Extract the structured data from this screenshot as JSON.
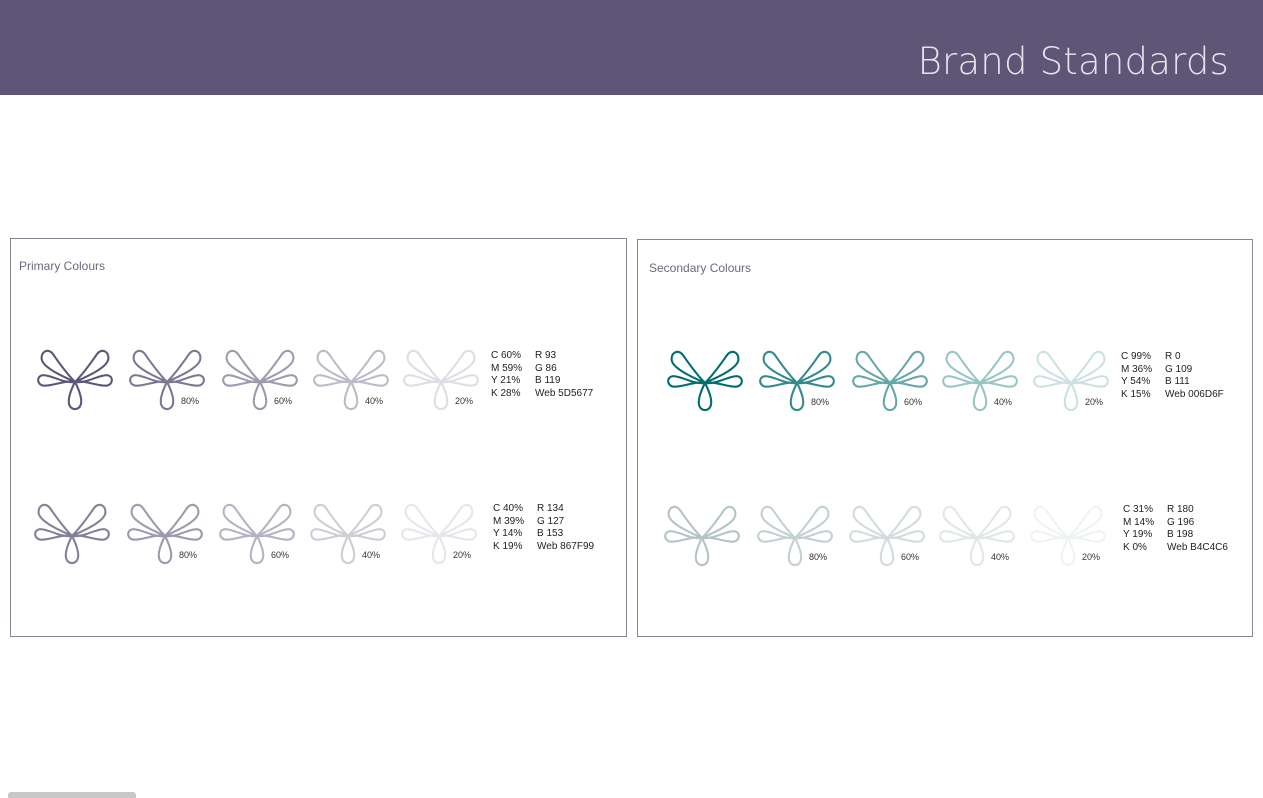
{
  "header": {
    "title": "Brand Standards",
    "bg_color": "#5d5677"
  },
  "primary": {
    "title": "Primary Colours",
    "rows": [
      {
        "color": "#5d5677",
        "tints": [
          {
            "value": 1.0,
            "label": ""
          },
          {
            "value": 0.8,
            "label": "80%"
          },
          {
            "value": 0.6,
            "label": "60%"
          },
          {
            "value": 0.4,
            "label": "40%"
          },
          {
            "value": 0.2,
            "label": "20%"
          }
        ],
        "cmyk": [
          "C 60%",
          "M 59%",
          "Y 21%",
          "K 28%"
        ],
        "rgb": [
          "R 93",
          "G 86",
          "B 119",
          "Web 5D5677"
        ]
      },
      {
        "color": "#867f99",
        "tints": [
          {
            "value": 1.0,
            "label": ""
          },
          {
            "value": 0.8,
            "label": "80%"
          },
          {
            "value": 0.6,
            "label": "60%"
          },
          {
            "value": 0.4,
            "label": "40%"
          },
          {
            "value": 0.2,
            "label": "20%"
          }
        ],
        "cmyk": [
          "C 40%",
          "M 39%",
          "Y 14%",
          "K 19%"
        ],
        "rgb": [
          "R 134",
          "G 127",
          "B 153",
          "Web 867F99"
        ]
      }
    ]
  },
  "secondary": {
    "title": "Secondary Colours",
    "rows": [
      {
        "color": "#006d6f",
        "tints": [
          {
            "value": 1.0,
            "label": ""
          },
          {
            "value": 0.8,
            "label": "80%"
          },
          {
            "value": 0.6,
            "label": "60%"
          },
          {
            "value": 0.4,
            "label": "40%"
          },
          {
            "value": 0.2,
            "label": "20%"
          }
        ],
        "cmyk": [
          "C 99%",
          "M 36%",
          "Y 54%",
          "K 15%"
        ],
        "rgb": [
          "R 0",
          "G 109",
          "B 111",
          "Web 006D6F"
        ]
      },
      {
        "color": "#b4c4c6",
        "tints": [
          {
            "value": 1.0,
            "label": ""
          },
          {
            "value": 0.8,
            "label": "80%"
          },
          {
            "value": 0.6,
            "label": "60%"
          },
          {
            "value": 0.4,
            "label": "40%"
          },
          {
            "value": 0.2,
            "label": "20%"
          }
        ],
        "cmyk": [
          "C 31%",
          "M 14%",
          "Y 19%",
          "K 0%"
        ],
        "rgb": [
          "R 180",
          "G 196",
          "B 198",
          "Web B4C4C6"
        ]
      }
    ]
  },
  "icons": {
    "swatch": "infinity-heart-icon"
  }
}
